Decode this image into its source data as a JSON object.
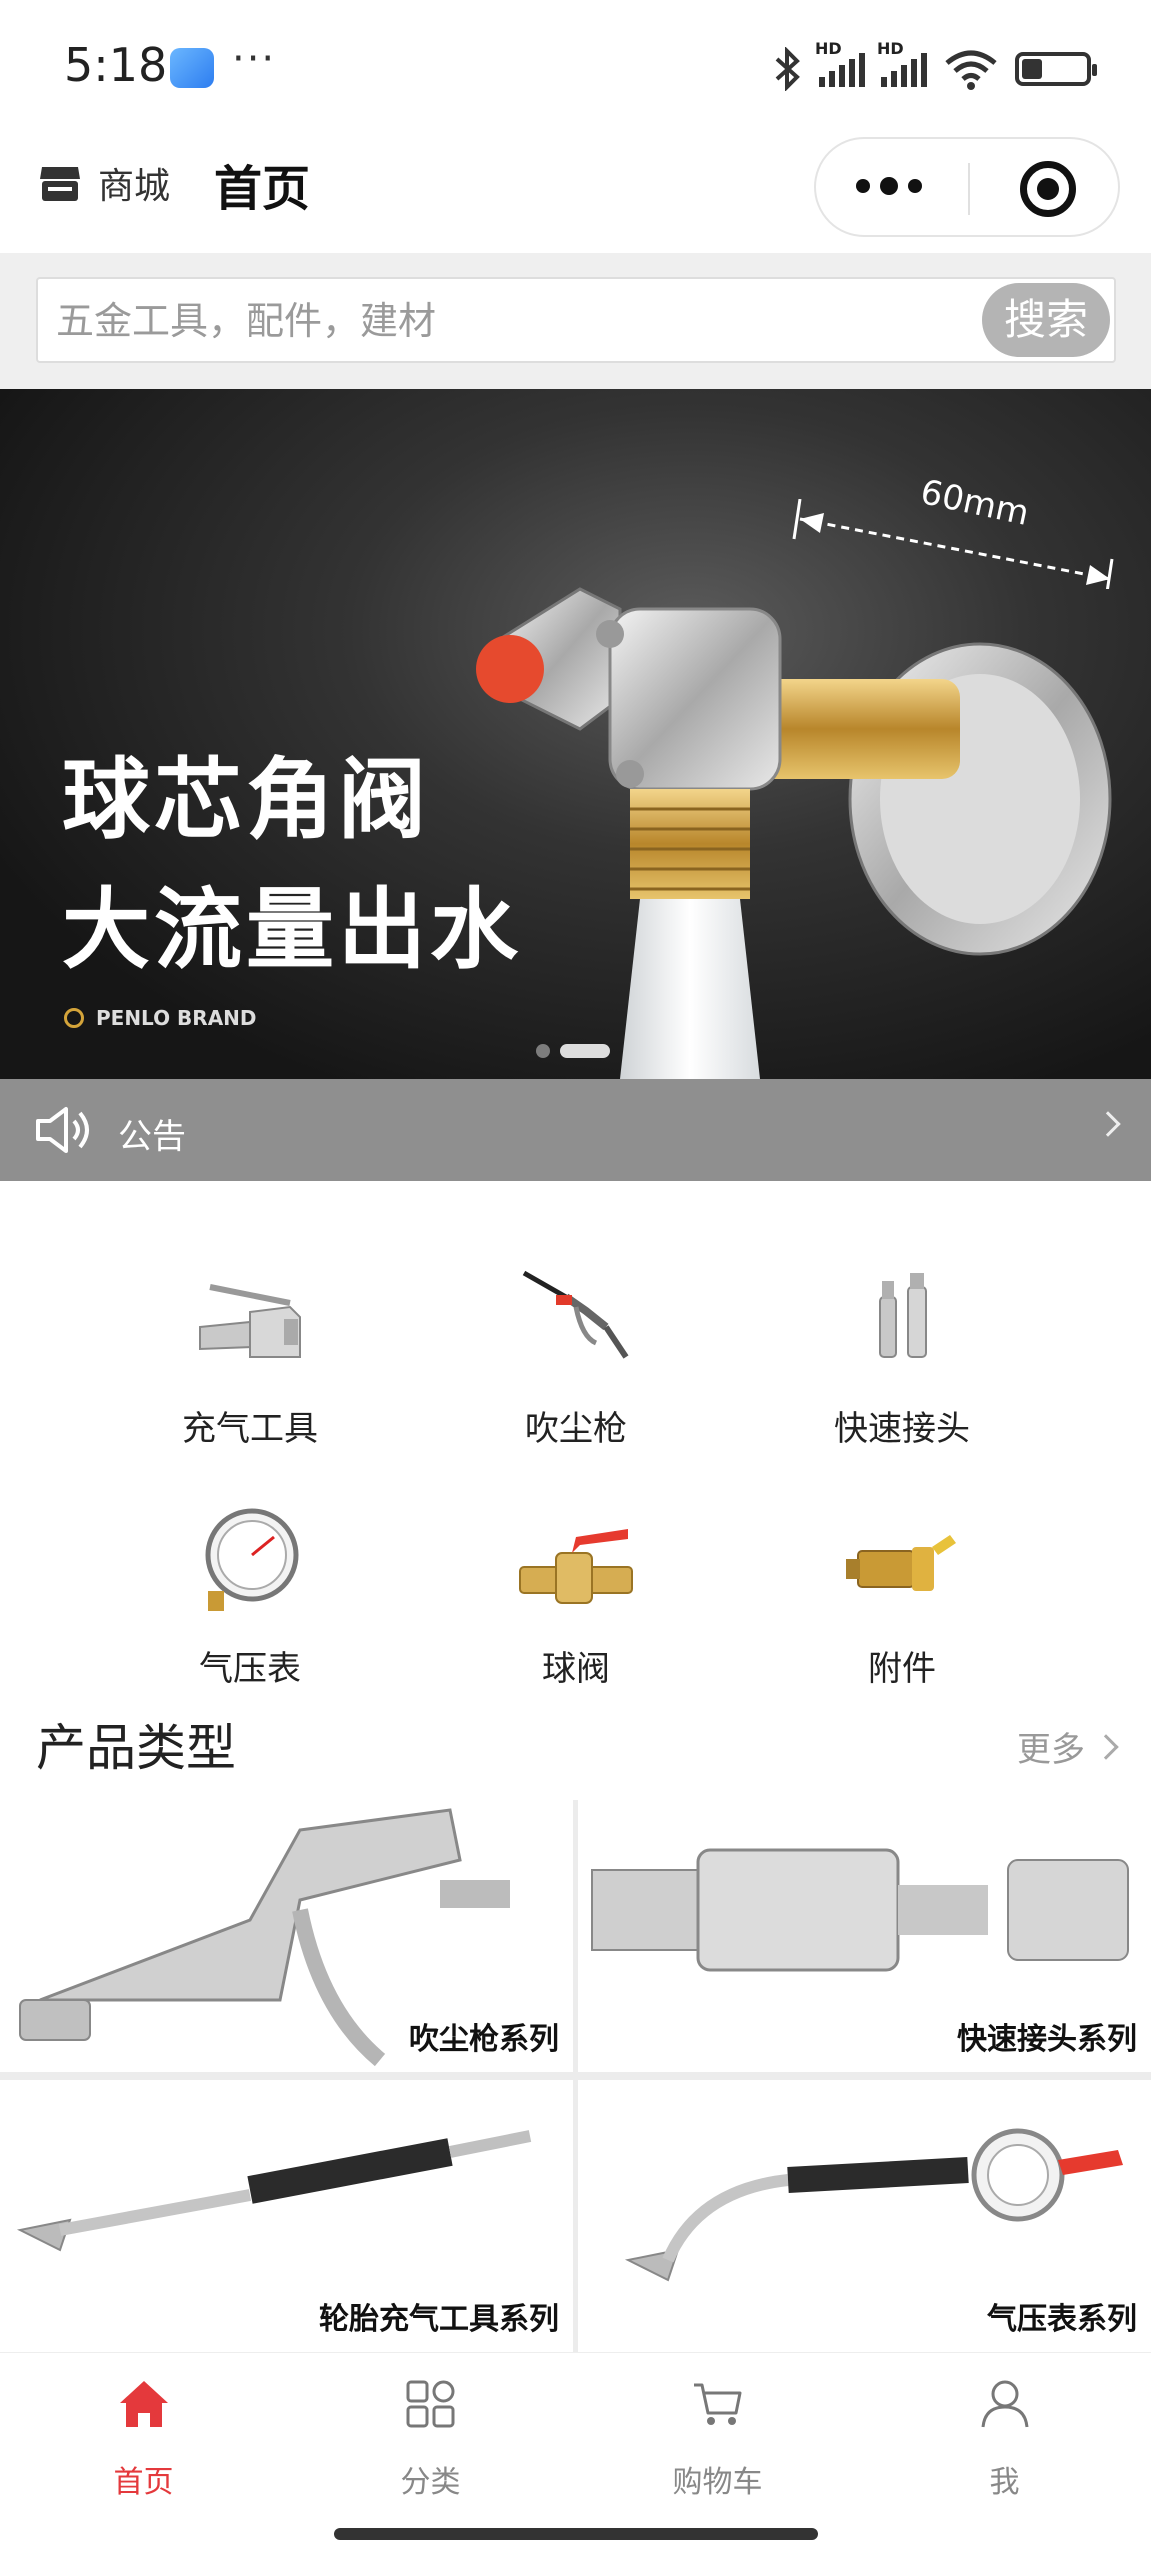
{
  "status_bar": {
    "time": "5:18",
    "dots": "···",
    "battery_level": 0.3,
    "icons": [
      "app-icon",
      "bluetooth-icon",
      "signal-hd-icon",
      "signal-hd-icon",
      "wifi-icon",
      "battery-icon"
    ]
  },
  "header": {
    "store_label": "商城",
    "title": "首页",
    "capsule_icons": [
      "more-icon",
      "target-icon"
    ]
  },
  "search": {
    "placeholder": "五金工具，配件，建材",
    "button_label": "搜索"
  },
  "banner": {
    "line1": "球芯角阀",
    "line2": "大流量出水",
    "brand": "PENLO BRAND",
    "dimension_label": "60mm",
    "slide_count": 2,
    "active_slide": 2
  },
  "notice": {
    "label": "公告"
  },
  "categories": [
    {
      "label": "充气工具"
    },
    {
      "label": "吹尘枪"
    },
    {
      "label": "快速接头"
    },
    {
      "label": "气压表"
    },
    {
      "label": "球阀"
    },
    {
      "label": "附件"
    }
  ],
  "products_section": {
    "title": "产品类型",
    "more": "更多"
  },
  "products": [
    {
      "label": "吹尘枪系列"
    },
    {
      "label": "快速接头系列"
    },
    {
      "label": "轮胎充气工具系列"
    },
    {
      "label": "气压表系列"
    }
  ],
  "bottom_nav": [
    {
      "label": "首页",
      "icon": "home-icon",
      "active": true
    },
    {
      "label": "分类",
      "icon": "grid-icon",
      "active": false
    },
    {
      "label": "购物车",
      "icon": "cart-icon",
      "active": false
    },
    {
      "label": "我",
      "icon": "user-icon",
      "active": false
    }
  ],
  "colors": {
    "accent": "#e4393c",
    "notice_bg": "#8f8f8f",
    "search_button": "#b4b4b4"
  }
}
